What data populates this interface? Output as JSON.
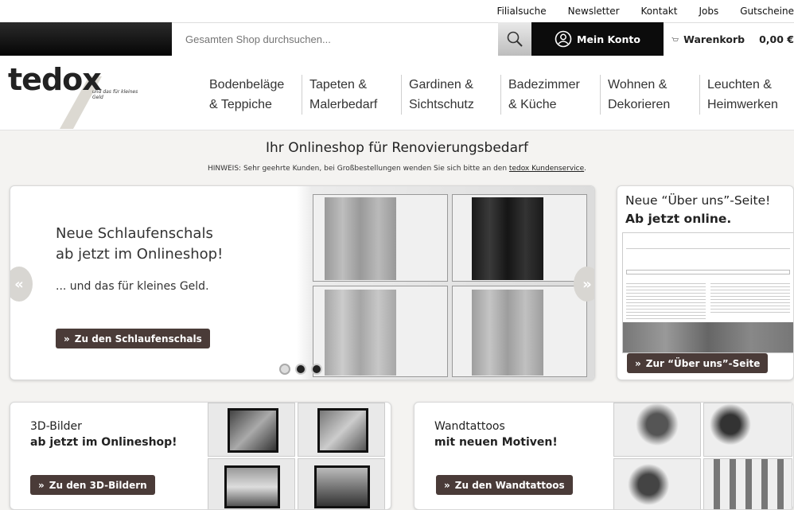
{
  "toplinks": [
    "Filialsuche",
    "Newsletter",
    "Kontakt",
    "Jobs",
    "Gutscheine"
  ],
  "search": {
    "placeholder": "Gesamten Shop durchsuchen..."
  },
  "account": {
    "label": "Mein Konto"
  },
  "cart": {
    "label": "Warenkorb",
    "amount": "0,00 €"
  },
  "logo": {
    "word": "tedox",
    "tagline": "und das für kleines Geld"
  },
  "nav": [
    {
      "line1": "Bodenbeläge",
      "line2": "& Teppiche"
    },
    {
      "line1": "Tapeten &",
      "line2": "Malerbedarf"
    },
    {
      "line1": "Gardinen &",
      "line2": "Sichtschutz"
    },
    {
      "line1": "Badezimmer",
      "line2": "& Küche"
    },
    {
      "line1": "Wohnen &",
      "line2": "Dekorieren"
    },
    {
      "line1": "Leuchten &",
      "line2": "Heimwerken"
    }
  ],
  "main": {
    "heading": "Ihr Onlineshop für Renovierungsbedarf",
    "hinweis_text": "HINWEIS: Sehr geehrte Kunden, bei Großbestellungen wenden Sie sich bitte an den",
    "hinweis_link": "tedox Kundenservice",
    "hinweis_end": "."
  },
  "slider": {
    "title_line1": "Neue Schlaufenschals",
    "title_line2": "ab jetzt im Onlineshop!",
    "subtitle": "... und das für kleines Geld.",
    "button": "Zu den Schlaufenschals",
    "prev_glyph": "«",
    "next_glyph": "»"
  },
  "about": {
    "title_line1": "Neue “Über uns”-Seite!",
    "title_line2": "Ab jetzt online.",
    "button": "Zur “Über uns”-Seite"
  },
  "card1": {
    "line1": "3D-Bilder",
    "line2": "ab jetzt im Onlineshop!",
    "button": "Zu den 3D-Bildern"
  },
  "card2": {
    "line1": "Wandtattoos",
    "line2": "mit neuen Motiven!",
    "button": "Zu den Wandtattoos"
  },
  "colors": {
    "button_bg": "#4a3b38",
    "topbar": "#0c0c0c"
  }
}
